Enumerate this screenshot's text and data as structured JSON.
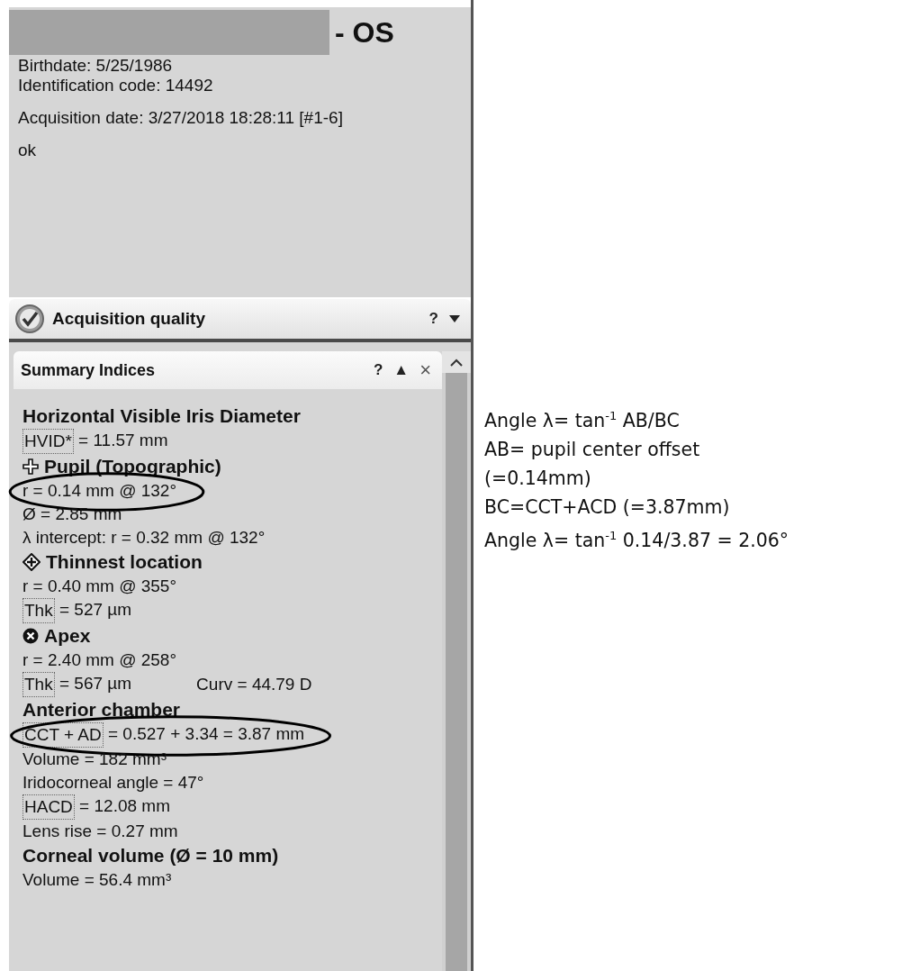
{
  "patient": {
    "eye": "- OS",
    "details": [
      "Birthdate: 5/25/1986",
      "Identification code: 14492"
    ],
    "acquisition": "Acquisition date: 3/27/2018 18:28:11 [#1-6]",
    "status": "ok"
  },
  "acquisition_quality": {
    "title": "Acquisition quality",
    "help": "?",
    "expanded": false
  },
  "summary": {
    "title": "Summary Indices",
    "help": "?",
    "collapse": "▲",
    "close": "×",
    "lines": [
      {
        "kind": "heading",
        "text": "Horizontal Visible Iris Diameter"
      },
      {
        "kind": "value",
        "term": "HVID*",
        "text": " = 11.57 mm",
        "circled": false
      },
      {
        "kind": "heading",
        "icon": {
          "kind": "cross"
        },
        "text": "Pupil (Topographic)"
      },
      {
        "kind": "value",
        "text": "r = 0.14 mm @ 132°",
        "circled": true
      },
      {
        "kind": "value",
        "text": "Ø = 2.85 mm",
        "circled": false
      },
      {
        "kind": "value",
        "text": "λ intercept: r = 0.32 mm @ 132°",
        "circled": false
      },
      {
        "kind": "heading",
        "icon": {
          "kind": "diamond"
        },
        "text": "Thinnest location"
      },
      {
        "kind": "value",
        "text": "r = 0.40 mm @ 355°",
        "circled": false
      },
      {
        "kind": "value",
        "term": "Thk",
        "text": " = 527 µm",
        "circled": false
      },
      {
        "kind": "heading",
        "icon": {
          "kind": "cancel"
        },
        "text": "Apex"
      },
      {
        "kind": "value",
        "text": "r = 2.40 mm @ 258°",
        "circled": false
      },
      {
        "kind": "value",
        "term": "Thk",
        "text": " = 567 µm",
        "extra": "Curv = 44.79 D",
        "circled": false
      },
      {
        "kind": "heading",
        "text": "Anterior chamber"
      },
      {
        "kind": "value",
        "term": "CCT + AD",
        "text": " = 0.527 + 3.34 = 3.87 mm",
        "circled": true
      },
      {
        "kind": "value",
        "text": "Volume = 182 mm³",
        "circled": false
      },
      {
        "kind": "value",
        "text": "Iridocorneal angle = 47°",
        "circled": false
      },
      {
        "kind": "value",
        "term": "HACD",
        "text": " = 12.08 mm",
        "circled": false
      },
      {
        "kind": "value",
        "text": "Lens rise = 0.27 mm",
        "circled": false
      },
      {
        "kind": "heading",
        "text": "Corneal volume (Ø = 10 mm)"
      },
      {
        "kind": "value",
        "text": "Volume = 56.4 mm³",
        "circled": false
      }
    ]
  },
  "notes": [
    "Angle λ= tan$^{-1}$ AB/BC",
    "AB= pupil center offset",
    "(=0.14mm)",
    "BC=CCT+ACD (=3.87mm)",
    "Angle λ= tan$^{-1}$ 0.14/3.87 = 2.06°"
  ]
}
